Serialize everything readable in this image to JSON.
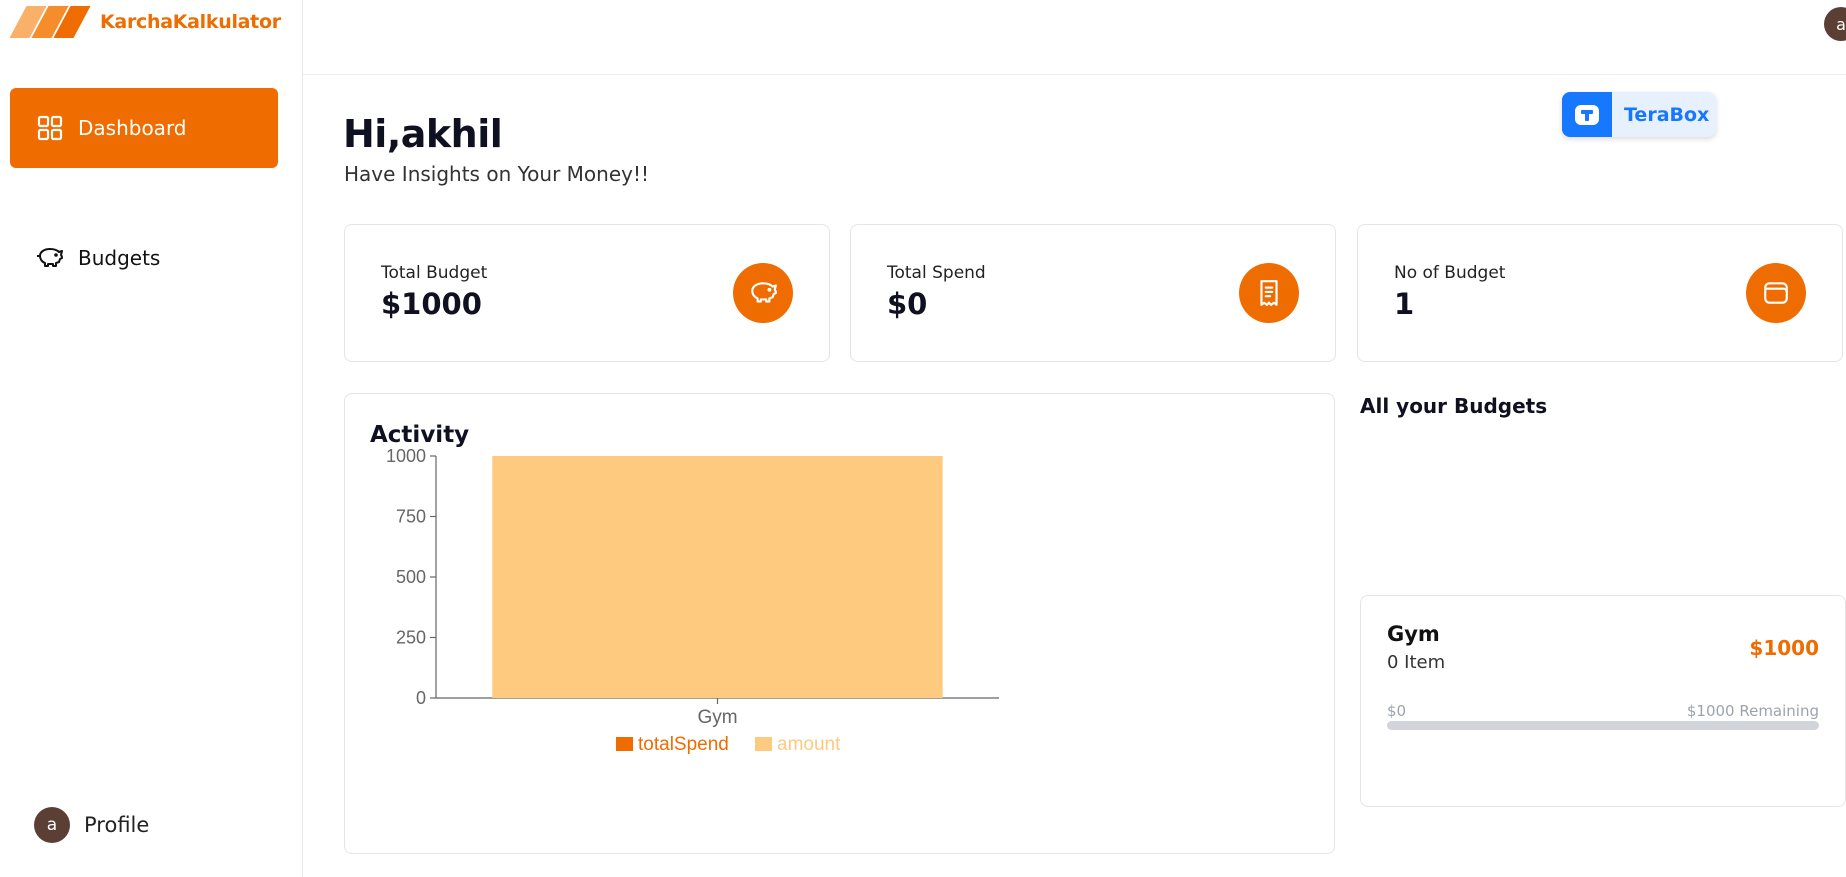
{
  "app": {
    "name": "KarchaKalkulator"
  },
  "sidebar": {
    "items": [
      {
        "label": "Dashboard",
        "icon": "layout-grid-icon",
        "active": true
      },
      {
        "label": "Budgets",
        "icon": "piggy-bank-icon",
        "active": false
      }
    ],
    "profile": {
      "label": "Profile",
      "avatar_letter": "a"
    }
  },
  "topbar": {
    "avatar_letter": "a"
  },
  "ad": {
    "label": "TeraBox",
    "color": "#1677ff"
  },
  "header": {
    "greeting": "Hi,akhil",
    "subtitle": "Have Insights on Your Money!!"
  },
  "stats": [
    {
      "label": "Total Budget",
      "value": "$1000",
      "icon": "piggy-bank-icon"
    },
    {
      "label": "Total Spend",
      "value": "$0",
      "icon": "receipt-icon"
    },
    {
      "label": "No of Budget",
      "value": "1",
      "icon": "wallet-icon"
    }
  ],
  "activity": {
    "title": "Activity"
  },
  "chart_data": {
    "type": "bar",
    "title": "Activity",
    "categories": [
      "Gym"
    ],
    "series": [
      {
        "name": "totalSpend",
        "values": [
          0
        ],
        "color": "#ef6c00"
      },
      {
        "name": "amount",
        "values": [
          1000
        ],
        "color": "#fdca80"
      }
    ],
    "yticks": [
      0,
      250,
      500,
      750,
      1000
    ],
    "ylim": [
      0,
      1000
    ],
    "stacked": true,
    "legend": "bottom-center"
  },
  "budgets": {
    "title": "All your Budgets",
    "items": [
      {
        "name": "Gym",
        "items_label": "0 Item",
        "amount": "$1000",
        "spent_label": "$0",
        "remaining_label": "$1000 Remaining",
        "progress": 0
      }
    ]
  },
  "theme": {
    "accent": "#ef6c00",
    "bar_light": "#fdca80"
  }
}
